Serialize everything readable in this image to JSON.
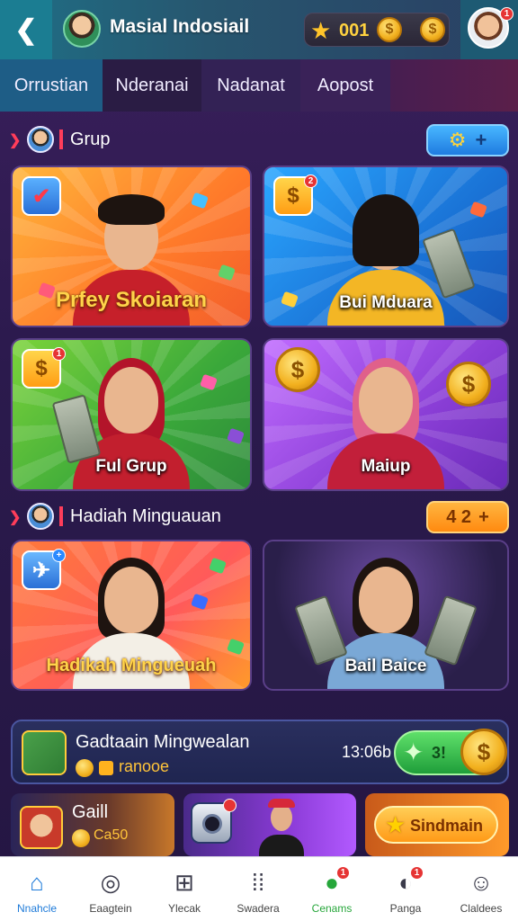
{
  "header": {
    "title": "Masial Indosiail",
    "coins": "001",
    "profile_badge": "1"
  },
  "tabs": [
    {
      "label": "Orrustian"
    },
    {
      "label": "Nderanai"
    },
    {
      "label": "Nadanat"
    },
    {
      "label": "Aopost"
    }
  ],
  "section1": {
    "title": "Grup"
  },
  "section2": {
    "title": "Hadiah Minguauan",
    "counter": "4 2"
  },
  "cards": [
    {
      "label": "Prfey Skoiaran"
    },
    {
      "label": "Bui Mduara",
      "badge": "2"
    },
    {
      "label": "Ful Grup",
      "badge": "1"
    },
    {
      "label": "Maiup"
    },
    {
      "label": "Hadikah Mingueuah"
    },
    {
      "label": "Bail Baice"
    }
  ],
  "weekly": {
    "title": "Gadtaain Mingwealan",
    "subtitle": "ranooe",
    "time": "13:06b",
    "button_text": "3!"
  },
  "mini": {
    "gail_title": "Gaill",
    "gail_sub": "Ca50",
    "button_label": "Sindmain"
  },
  "nav": [
    {
      "label": "Nnahcle",
      "badge": ""
    },
    {
      "label": "Eaagtein",
      "badge": ""
    },
    {
      "label": "Ylecak",
      "badge": ""
    },
    {
      "label": "Swadera",
      "badge": ""
    },
    {
      "label": "Cenams",
      "badge": "1"
    },
    {
      "label": "Panga",
      "badge": "1"
    },
    {
      "label": "Claldees",
      "badge": ""
    }
  ],
  "colors": {
    "accent_blue": "#1d7ad9",
    "accent_green": "#26a63a",
    "accent_red": "#ff3d5a",
    "gold": "#ffd34a"
  }
}
